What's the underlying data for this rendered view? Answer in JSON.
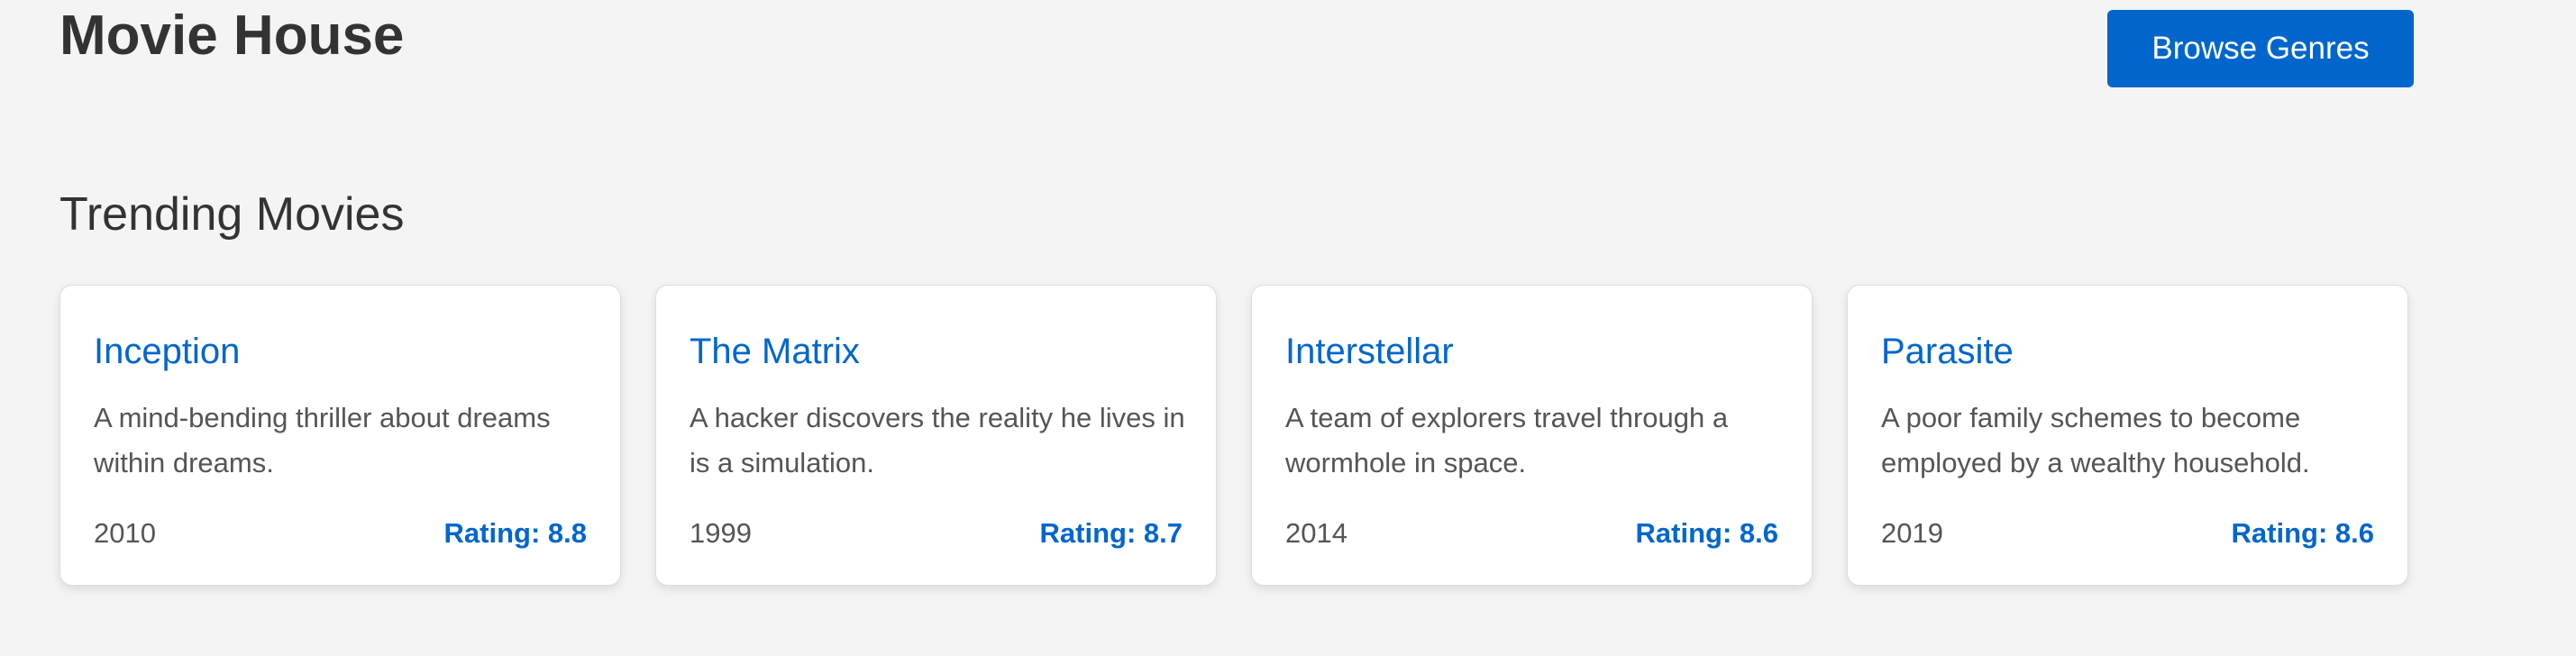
{
  "header": {
    "title": "Movie House",
    "browse_label": "Browse Genres"
  },
  "section": {
    "title": "Trending Movies"
  },
  "movies": [
    {
      "title": "Inception",
      "description": "A mind-bending thriller about dreams within dreams.",
      "year": "2010",
      "rating": "Rating: 8.8"
    },
    {
      "title": "The Matrix",
      "description": "A hacker discovers the reality he lives in is a simulation.",
      "year": "1999",
      "rating": "Rating: 8.7"
    },
    {
      "title": "Interstellar",
      "description": "A team of explorers travel through a wormhole in space.",
      "year": "2014",
      "rating": "Rating: 8.6"
    },
    {
      "title": "Parasite",
      "description": "A poor family schemes to become employed by a wealthy household.",
      "year": "2019",
      "rating": "Rating: 8.6"
    }
  ],
  "colors": {
    "accent": "#0066cc",
    "background": "#f4f4f4",
    "card": "#ffffff",
    "text": "#333333",
    "muted": "#555555"
  }
}
